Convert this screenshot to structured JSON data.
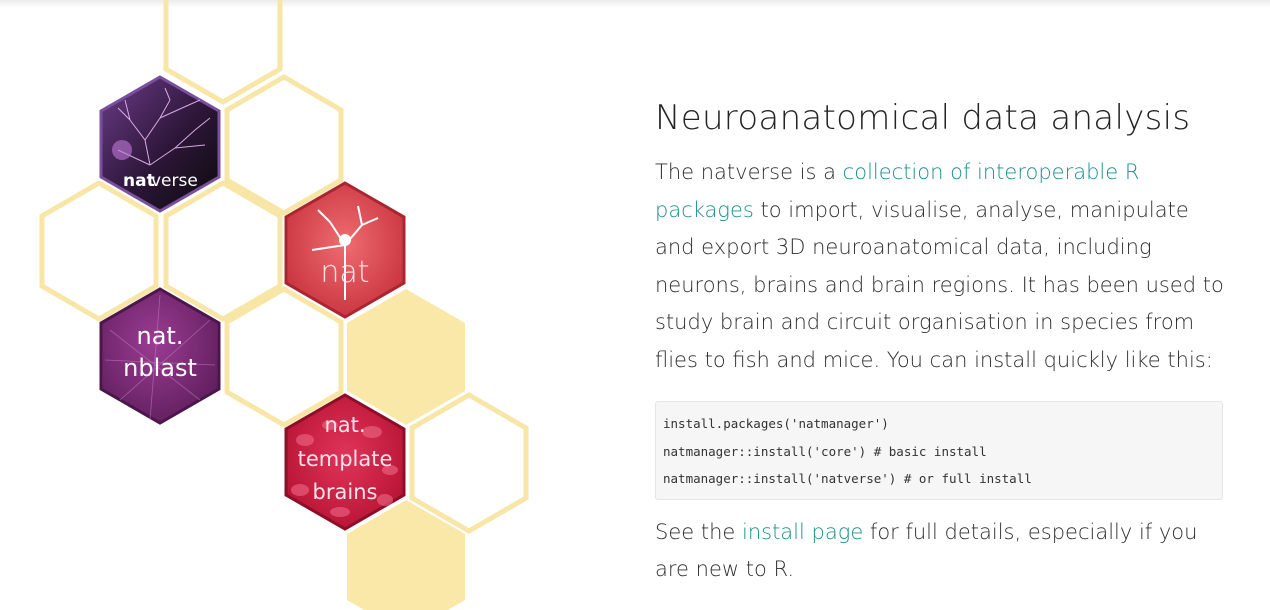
{
  "logos": {
    "natverse": {
      "line1": "nat",
      "line2": "verse"
    },
    "nat": {
      "line1": "nat"
    },
    "nblast": {
      "line1": "nat.",
      "line2": "nblast"
    },
    "template": {
      "line1": "nat.",
      "line2": "template",
      "line3": "brains"
    }
  },
  "main": {
    "heading": "Neuroanatomical data analysis",
    "intro_prefix": "The natverse is a ",
    "intro_link": "collection of interoperable R packages",
    "intro_suffix": " to import, visualise, analyse, manipulate and export 3D neuroanatomical data, including neurons, brains and brain regions. It has been used to study brain and circuit organisation in species from flies to fish and mice. You can install quickly like this:",
    "code_lines": [
      "install.packages('natmanager')",
      "natmanager::install('core') # basic install",
      "natmanager::install('natverse') # or full install"
    ],
    "see_prefix": "See the ",
    "see_link": "install page",
    "see_suffix": " for full details, especially if you are new to R."
  },
  "colors": {
    "hex_outline": "#f8e6a6",
    "hex_fill": "#f9e8a8",
    "link": "#1d8f8a",
    "nat_red": "#d4434d",
    "nblast_purple": "#7b2a78",
    "template_red": "#c81a3d",
    "natverse_dark": "#3a1a4a"
  }
}
